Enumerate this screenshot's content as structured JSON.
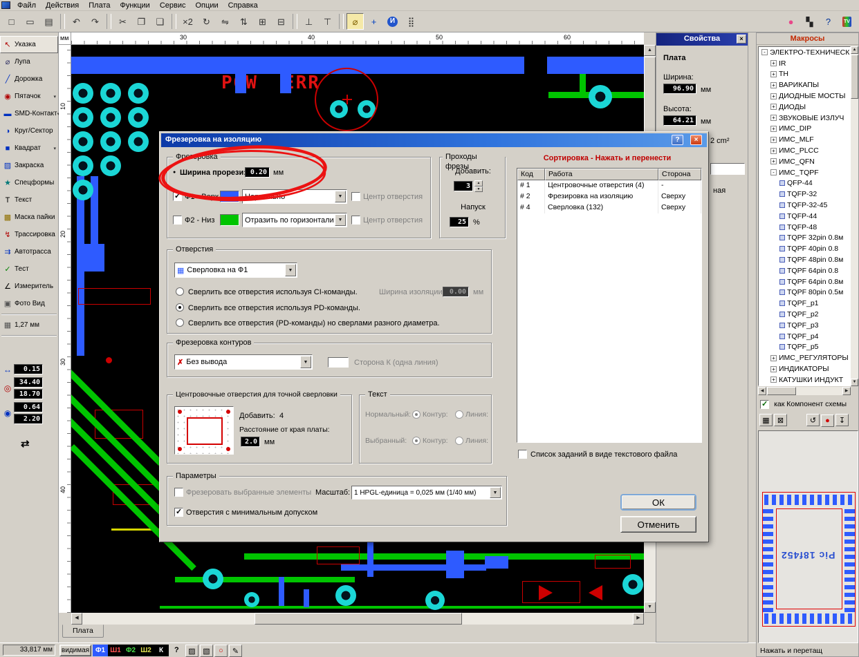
{
  "menubar": {
    "items": [
      "Файл",
      "Действия",
      "Плата",
      "Функции",
      "Сервис",
      "Опции",
      "Справка"
    ]
  },
  "toolbar": {
    "left": [
      {
        "name": "new",
        "glyph": "□"
      },
      {
        "name": "open",
        "glyph": "▭"
      },
      {
        "name": "save",
        "glyph": "▤"
      },
      {
        "sep": true
      },
      {
        "name": "undo",
        "glyph": "↶"
      },
      {
        "name": "redo",
        "glyph": "↷"
      },
      {
        "sep": true
      },
      {
        "name": "cut",
        "glyph": "✂"
      },
      {
        "name": "copy",
        "glyph": "❐"
      },
      {
        "name": "paste",
        "glyph": "❏"
      },
      {
        "sep": true
      },
      {
        "name": "duplicate",
        "glyph": "×2"
      },
      {
        "name": "rotate",
        "glyph": "↻"
      },
      {
        "name": "mirror-horizontal",
        "glyph": "⇋"
      },
      {
        "name": "mirror-vertical",
        "glyph": "⇅"
      },
      {
        "name": "group",
        "glyph": "⊞"
      },
      {
        "name": "ungroup",
        "glyph": "⊟"
      },
      {
        "sep": true
      },
      {
        "name": "pin-top",
        "glyph": "⊥"
      },
      {
        "name": "pin-bottom",
        "glyph": "⊤"
      },
      {
        "sep": true
      },
      {
        "name": "zoom",
        "glyph": "⌀",
        "active": true,
        "color": "#806000"
      },
      {
        "name": "snap-cross",
        "glyph": "+",
        "color": "#0040c0"
      },
      {
        "name": "info",
        "glyph": "И",
        "circle": true
      },
      {
        "name": "dot-grid",
        "glyph": "⣿",
        "color": "#222222"
      }
    ],
    "right": [
      {
        "name": "pink-dot",
        "glyph": "●",
        "color": "#e8488a"
      },
      {
        "name": "negative",
        "glyph": "▚",
        "color": "#222222"
      },
      {
        "name": "help",
        "glyph": "?",
        "color": "#003399"
      },
      {
        "name": "tv",
        "glyph": "TV",
        "tv": true
      }
    ]
  },
  "sidebar": {
    "tools": [
      {
        "name": "pointer",
        "label": "Указка",
        "glyph": "↖",
        "color": "#b00000",
        "selected": true
      },
      {
        "name": "zoom",
        "label": "Лупа",
        "glyph": "⌀",
        "color": "#333366"
      },
      {
        "name": "track",
        "label": "Дорожка",
        "glyph": "╱",
        "color": "#0030c0"
      },
      {
        "name": "pad",
        "label": "Пятачок",
        "glyph": "◉",
        "color": "#b00000",
        "arrow": true
      },
      {
        "name": "smd-contact",
        "label": "SMD-Контакт",
        "glyph": "▬",
        "color": "#0030c0",
        "arrow": true
      },
      {
        "name": "circle-sector",
        "label": "Круг/Сектор",
        "glyph": "◑",
        "color": "#0030c0"
      },
      {
        "name": "square",
        "label": "Квадрат",
        "glyph": "■",
        "color": "#0030c0",
        "arrow": true
      },
      {
        "name": "fill",
        "label": "Закраска",
        "glyph": "▨",
        "color": "#0030c0"
      },
      {
        "name": "special-shapes",
        "label": "Спецформы",
        "glyph": "★",
        "color": "#007878"
      },
      {
        "name": "text",
        "label": "Текст",
        "glyph": "T",
        "color": "#000000"
      },
      {
        "name": "solder-mask",
        "label": "Маска пайки",
        "glyph": "▩",
        "color": "#907000"
      },
      {
        "name": "routing",
        "label": "Трассировка",
        "glyph": "↯",
        "color": "#b00000"
      },
      {
        "name": "autoroute",
        "label": "Автотрасса",
        "glyph": "⇉",
        "color": "#0030c0"
      },
      {
        "name": "test",
        "label": "Тест",
        "glyph": "✓",
        "color": "#008000"
      },
      {
        "name": "measure",
        "label": "Измеритель",
        "glyph": "∠",
        "color": "#000000"
      },
      {
        "name": "photo-view",
        "label": "Фото Вид",
        "glyph": "▣",
        "color": "#555555",
        "sep_after": true
      },
      {
        "name": "grid-step",
        "label": "1,27 мм",
        "glyph": "▦",
        "color": "#555555",
        "sep_after": true
      }
    ],
    "params": [
      {
        "name": "track-width",
        "glyph": "↔",
        "color": "#0030c0",
        "values": [
          "0.15"
        ]
      },
      {
        "name": "pad-size",
        "glyph": "◎",
        "color": "#b00000",
        "values": [
          "34.40",
          "18.70"
        ]
      },
      {
        "name": "drill-size",
        "glyph": "◉",
        "color": "#0030c0",
        "values": [
          "0.64",
          "2.20"
        ]
      }
    ],
    "swap_glyph": "⇄"
  },
  "ruler": {
    "unit": "мм",
    "top": [
      "30",
      "40",
      "50",
      "60"
    ],
    "left": [
      "10",
      "20",
      "30",
      "40"
    ]
  },
  "canvas": {
    "pow": "POW",
    "err": "ERR",
    "tab": "Плата"
  },
  "dialog": {
    "title": "Фрезеровка на изоляцию",
    "help_glyph": "?",
    "close_glyph": "×",
    "milling": {
      "title": "Фрезеровка",
      "slot_label": "Ширина прорези:",
      "slot_value": "0.20",
      "slot_unit": "мм",
      "rows": [
        {
          "label": "Ф1 - Верх",
          "checked": true,
          "swatch": "#2e5bff",
          "mode": "Нормально",
          "center": "Центр отверстия"
        },
        {
          "label": "Ф2 - Низ",
          "checked": false,
          "swatch": "#00c400",
          "mode": "Отразить по горизонтали",
          "center": "Центр отверстия"
        }
      ]
    },
    "passes": {
      "title": "Проходы фрезы",
      "add_label": "Добавить:",
      "add_value": "3",
      "overlap_label": "Напуск",
      "overlap_value": "25",
      "overlap_unit": "%"
    },
    "holes": {
      "title": "Отверстия",
      "drill_combo": "Сверловка на Ф1",
      "radio1": "Сверлить все отверстия используя CI-команды.",
      "radio2": "Сверлить все отверстия используя PD-команды.",
      "radio3": "Сверлить все отверстия (PD-команды) но сверлами разного диаметра.",
      "iso_label": "Ширина изоляции",
      "iso_value": "0.00",
      "iso_unit": "мм"
    },
    "contour": {
      "title": "Фрезеровка контуров",
      "combo": "Без вывода",
      "combo_glyph": "✗",
      "side_label": "Сторона К (одна линия)"
    },
    "centering": {
      "title": "Центровочные отверстия для точной сверловки",
      "add_label": "Добавить:",
      "add_value": "4",
      "dist_label": "Расстояние от края платы:",
      "dist_value": "2.0",
      "dist_unit": "мм"
    },
    "text_group": {
      "title": "Текст",
      "normal": "Нормальный:",
      "selected": "Выбранный:",
      "contour": "Контур:",
      "line": "Линия:"
    },
    "params": {
      "title": "Параметры",
      "mill_sel": "Фрезеровать выбранные элементы",
      "scale_label": "Масштаб:",
      "scale_value": "1 HPGL-единица = 0,025 мм (1/40 мм)",
      "min_tol": "Отверстия с минимальным допуском"
    },
    "sorting": {
      "title": "Сортировка - Нажать и перенести",
      "columns": [
        "Код",
        "Работа",
        "Сторона"
      ],
      "rows": [
        [
          "# 1",
          "Центровочные отверстия (4)",
          "-"
        ],
        [
          "# 2",
          "Фрезировка на изоляцию",
          "Сверху"
        ],
        [
          "# 4",
          "Сверловка (132)",
          "Сверху"
        ]
      ],
      "file_checkbox": "Список заданий в виде текстового файла"
    },
    "ok": "ОК",
    "cancel": "Отменить"
  },
  "properties": {
    "title": "Свойства",
    "close_glyph": "×",
    "section": "Плата",
    "width_label": "Ширина:",
    "width_value": "96.90",
    "width_unit": "мм",
    "height_label": "Высота:",
    "height_value": "64.21",
    "height_unit": "мм",
    "area_partial": "2 cm²",
    "partial_text": "ная"
  },
  "macros": {
    "title": "Макросы",
    "tree": [
      {
        "label": "ЭЛЕКТРО-ТЕХНИЧЕСК",
        "level": 0,
        "exp": "-"
      },
      {
        "label": "IR",
        "level": 1,
        "exp": "+"
      },
      {
        "label": "TH",
        "level": 1,
        "exp": "+"
      },
      {
        "label": "ВАРИКАПЫ",
        "level": 1,
        "exp": "+"
      },
      {
        "label": "ДИОДНЫЕ МОСТЫ",
        "level": 1,
        "exp": "+"
      },
      {
        "label": "ДИОДЫ",
        "level": 1,
        "exp": "+"
      },
      {
        "label": "ЗВУКОВЫЕ ИЗЛУЧ",
        "level": 1,
        "exp": "+"
      },
      {
        "label": "ИМС_DIP",
        "level": 1,
        "exp": "+"
      },
      {
        "label": "ИМС_MLF",
        "level": 1,
        "exp": "+"
      },
      {
        "label": "ИМС_PLCC",
        "level": 1,
        "exp": "+"
      },
      {
        "label": "ИМС_QFN",
        "level": 1,
        "exp": "+"
      },
      {
        "label": "ИМС_TQPF",
        "level": 1,
        "exp": "-"
      },
      {
        "label": "QFP-44",
        "level": 2
      },
      {
        "label": "TQFP-32",
        "level": 2
      },
      {
        "label": "TQFP-32-45",
        "level": 2
      },
      {
        "label": "TQFP-44",
        "level": 2
      },
      {
        "label": "TQFP-48",
        "level": 2
      },
      {
        "label": "TQPF 32pin 0.8м",
        "level": 2
      },
      {
        "label": "TQPF 40pin 0.8",
        "level": 2
      },
      {
        "label": "TQPF 48pin 0.8м",
        "level": 2
      },
      {
        "label": "TQPF 64pin 0.8",
        "level": 2
      },
      {
        "label": "TQPF 64pin 0.8м",
        "level": 2
      },
      {
        "label": "TQPF 80pin 0.5м",
        "level": 2
      },
      {
        "label": "TQPF_p1",
        "level": 2
      },
      {
        "label": "TQPF_p2",
        "level": 2
      },
      {
        "label": "TQPF_p3",
        "level": 2
      },
      {
        "label": "TQPF_p4",
        "level": 2
      },
      {
        "label": "TQPF_p5",
        "level": 2
      },
      {
        "label": "ИМС_РЕГУЛЯТОРЫ",
        "level": 1,
        "exp": "+"
      },
      {
        "label": "ИНДИКАТОРЫ",
        "level": 1,
        "exp": "+"
      },
      {
        "label": "КАТУШКИ ИНДУКТ",
        "level": 1,
        "exp": "+"
      }
    ],
    "component_checkbox": "как Компонент схемы",
    "actions": [
      {
        "name": "save-macro",
        "glyph": "▦"
      },
      {
        "name": "delete-macro",
        "glyph": "⊠"
      },
      {
        "name": "rotate-macro",
        "glyph": "↺",
        "gap": true
      },
      {
        "name": "record-macro",
        "glyph": "●",
        "color": "#d00000"
      },
      {
        "name": "export-macro",
        "glyph": "↧"
      }
    ],
    "preview_text": "Pic 18f452",
    "footer": "Нажать и перетащ"
  },
  "statusbar": {
    "coords": "33,817 мм",
    "visible_btn": "видимая",
    "help": "?",
    "layers": [
      {
        "label": "Ф1",
        "fg": "#ffffff",
        "bg": "#2e5bff"
      },
      {
        "label": "Ш1",
        "fg": "#ff5050"
      },
      {
        "label": "Ф2",
        "fg": "#4ae04a"
      },
      {
        "label": "Ш2",
        "fg": "#e0e050"
      },
      {
        "label": "К",
        "fg": "#ffffff"
      }
    ],
    "buttons": [
      {
        "name": "hatch1",
        "glyph": "▨"
      },
      {
        "name": "hatch2",
        "glyph": "▧"
      },
      {
        "name": "pad-ring",
        "glyph": "○",
        "color": "#d00000"
      },
      {
        "name": "pencil",
        "glyph": "✎"
      }
    ]
  },
  "icons": {
    "up": "▲",
    "down": "▼",
    "left": "◀",
    "right": "▶",
    "dropdown": "▼",
    "bullet": "●"
  }
}
